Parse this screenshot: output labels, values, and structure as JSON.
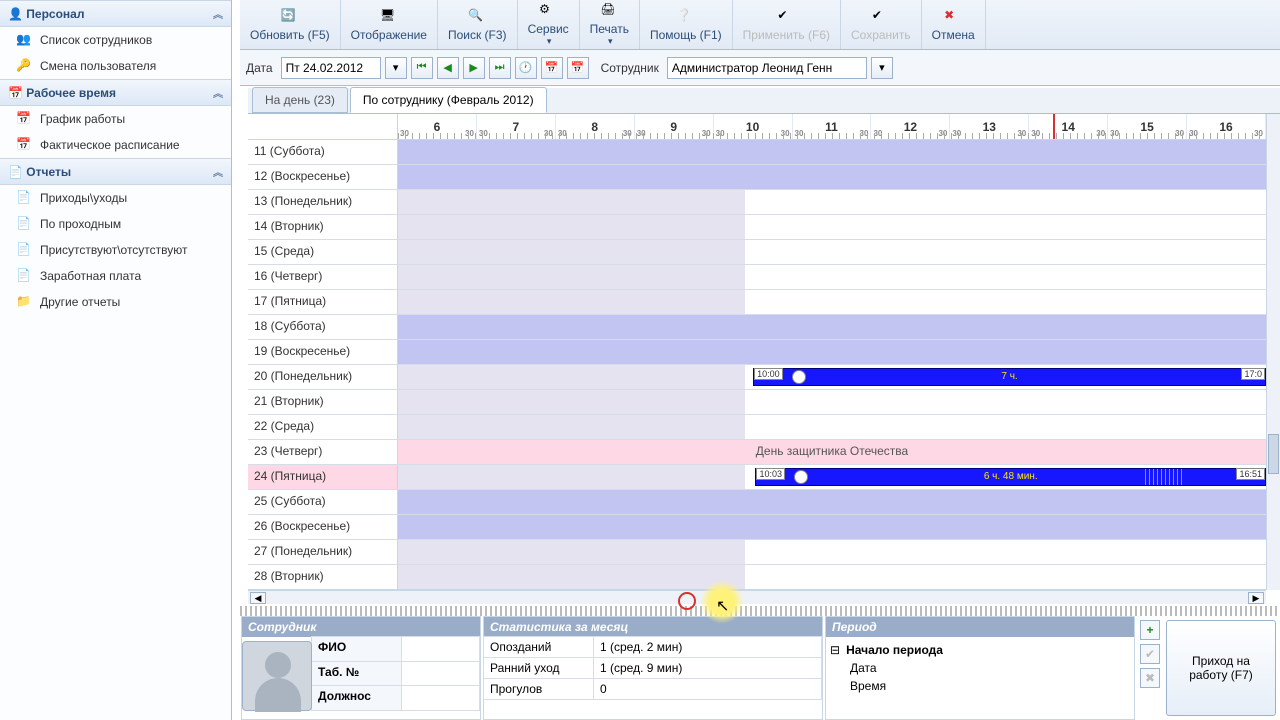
{
  "toolbar": {
    "refresh": "Обновить (F5)",
    "display": "Отображение",
    "search": "Поиск (F3)",
    "service": "Сервис",
    "print": "Печать",
    "help": "Помощь (F1)",
    "apply": "Применить (F6)",
    "save": "Сохранить",
    "cancel": "Отмена"
  },
  "datebar": {
    "date_label": "Дата",
    "date_value": "Пт 24.02.2012",
    "employee_label": "Сотрудник",
    "employee_value": "Администратор Леонид Генн"
  },
  "sidebar": {
    "sections": [
      {
        "title": "Персонал",
        "items": [
          "Список сотрудников",
          "Смена пользователя"
        ]
      },
      {
        "title": "Рабочее время",
        "items": [
          "График работы",
          "Фактическое расписание"
        ]
      },
      {
        "title": "Отчеты",
        "items": [
          "Приходы\\уходы",
          "По проходным",
          "Присутствуют\\отсутствуют",
          "Заработная плата",
          "Другие отчеты"
        ]
      }
    ]
  },
  "tabs": {
    "day": "На день (23)",
    "employee": "По сотруднику (Февраль 2012)"
  },
  "hours": [
    "6",
    "7",
    "8",
    "9",
    "10",
    "11",
    "12",
    "13",
    "14",
    "15",
    "16"
  ],
  "half_label": "30",
  "redline_hour": 13.8,
  "rows": [
    {
      "label": "11 (Суббота)",
      "type": "weekend"
    },
    {
      "label": "12 (Воскресенье)",
      "type": "weekend"
    },
    {
      "label": "13 (Понедельник)",
      "type": "workday"
    },
    {
      "label": "14 (Вторник)",
      "type": "workday"
    },
    {
      "label": "15 (Среда)",
      "type": "workday"
    },
    {
      "label": "16 (Четверг)",
      "type": "workday"
    },
    {
      "label": "17 (Пятница)",
      "type": "workday"
    },
    {
      "label": "18 (Суббота)",
      "type": "weekend"
    },
    {
      "label": "19 (Воскресенье)",
      "type": "weekend"
    },
    {
      "label": "20 (Понедельник)",
      "type": "workday",
      "bar": {
        "start": "10:00",
        "end": "17:0",
        "mid": "7 ч."
      }
    },
    {
      "label": "21 (Вторник)",
      "type": "workday"
    },
    {
      "label": "22 (Среда)",
      "type": "workday"
    },
    {
      "label": "23 (Четверг)",
      "type": "holiday",
      "holiday_text": "День защитника Отечества"
    },
    {
      "label": "24 (Пятница)",
      "type": "workday",
      "selected": true,
      "bar": {
        "start": "10:03",
        "end": "16:51",
        "mid": "6 ч. 48 мин."
      }
    },
    {
      "label": "25 (Суббота)",
      "type": "weekend"
    },
    {
      "label": "26 (Воскресенье)",
      "type": "weekend"
    },
    {
      "label": "27 (Понедельник)",
      "type": "workday"
    },
    {
      "label": "28 (Вторник)",
      "type": "workday"
    }
  ],
  "bottom": {
    "employee_title": "Сотрудник",
    "stats_title": "Статистика за месяц",
    "period_title": "Период",
    "emp_fields": [
      {
        "label": "ФИО",
        "value": ""
      },
      {
        "label": "Таб. №",
        "value": ""
      },
      {
        "label": "Должнос",
        "value": ""
      }
    ],
    "stat_fields": [
      {
        "label": "Опозданий",
        "value": "1 (сред. 2 мин)"
      },
      {
        "label": "Ранний уход",
        "value": "1 (сред. 9 мин)"
      },
      {
        "label": "Прогулов",
        "value": "0"
      }
    ],
    "period_start": "Начало периода",
    "period_date": "Дата",
    "period_time": "Время",
    "arrive_btn": "Приход на работу (F7)"
  }
}
